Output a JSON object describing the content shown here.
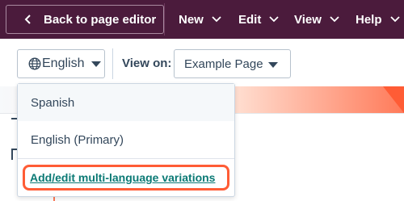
{
  "header": {
    "back_label": "Back to page editor",
    "nav": [
      {
        "label": "New"
      },
      {
        "label": "Edit"
      },
      {
        "label": "View"
      },
      {
        "label": "Help"
      }
    ],
    "colors": {
      "bar": "#4b1b3c"
    }
  },
  "toolbar": {
    "language_button": {
      "label": "English",
      "icon": "globe-icon"
    },
    "view_on_label": "View on:",
    "view_select_value": "Example Page"
  },
  "language_menu": {
    "items": [
      {
        "label": "Spanish",
        "state": "hover"
      },
      {
        "label": "English (Primary)",
        "state": "normal"
      }
    ],
    "action_link": "Add/edit multi-language variations",
    "highlight_color": "#ff5c35",
    "link_color": "#0b7a75"
  }
}
